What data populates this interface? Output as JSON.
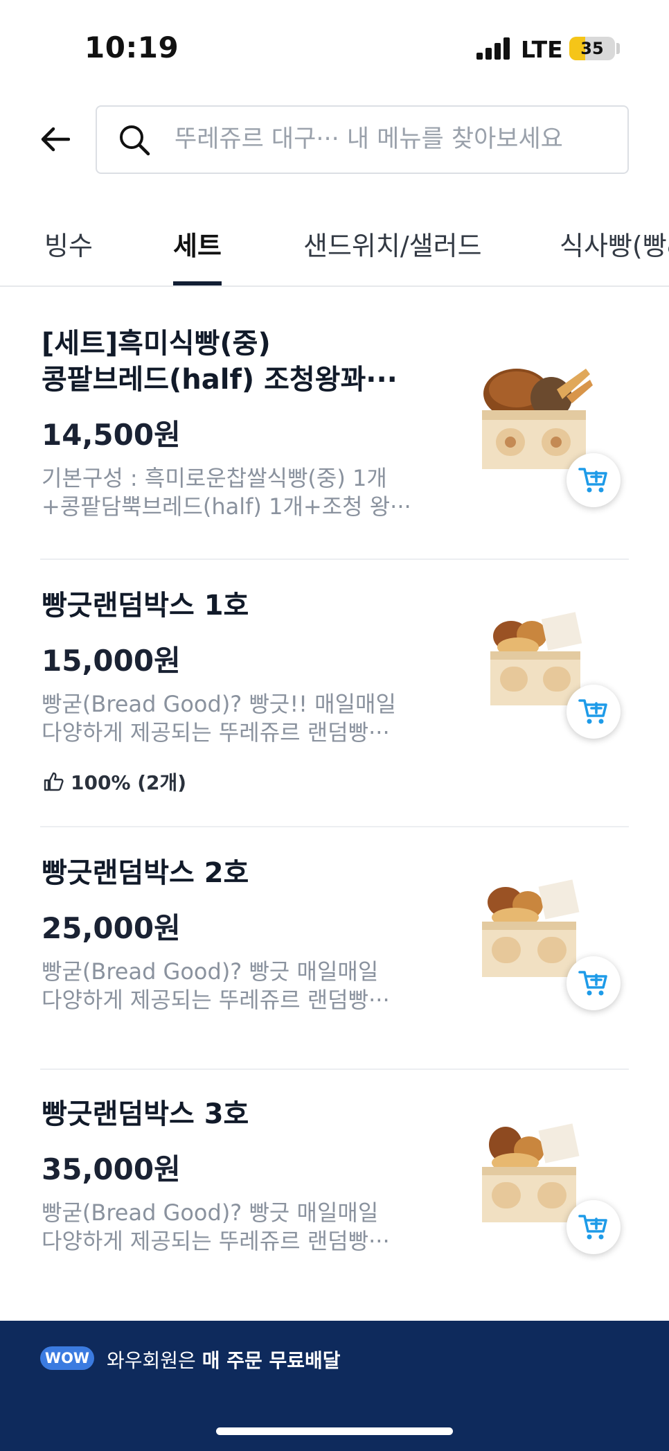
{
  "status_bar": {
    "time": "10:19",
    "network": "LTE",
    "battery": "35",
    "battery_level_percent": 35,
    "battery_color": "#f5c518"
  },
  "header": {
    "back_icon": "arrow-left-icon",
    "search_icon": "search-icon",
    "search_placeholder": "뚜레쥬르 대구··· 내 메뉴를 찾아보세요"
  },
  "tabs": [
    {
      "label": "빙수",
      "active": false
    },
    {
      "label": "세트",
      "active": true
    },
    {
      "label": "샌드위치/샐러드",
      "active": false
    },
    {
      "label": "식사빵(빵&",
      "active": false
    }
  ],
  "products": [
    {
      "name_line1": "[세트]흑미식빵(중)",
      "name_line2": "콩팥브레드(half) 조청왕꽈···",
      "price": "14,500원",
      "desc_line1": "기본구성 : 흑미로운찹쌀식빵(중) 1개",
      "desc_line2": "+콩팥담뿍브레드(half) 1개+조청 왕···",
      "rating": ""
    },
    {
      "name_line1": "빵긋랜덤박스 1호",
      "name_line2": "",
      "price": "15,000원",
      "desc_line1": "빵굳(Bread Good)? 빵긋!! 매일매일",
      "desc_line2": "다양하게 제공되는 뚜레쥬르 랜덤빵···",
      "rating": "100% (2개)"
    },
    {
      "name_line1": "빵긋랜덤박스 2호",
      "name_line2": "",
      "price": "25,000원",
      "desc_line1": "빵굳(Bread Good)? 빵긋 매일매일",
      "desc_line2": "다양하게 제공되는 뚜레쥬르 랜덤빵···",
      "rating": ""
    },
    {
      "name_line1": "빵긋랜덤박스 3호",
      "name_line2": "",
      "price": "35,000원",
      "desc_line1": "빵굳(Bread Good)? 빵긋 매일매일",
      "desc_line2": "다양하게 제공되는 뚜레쥬르 랜덤빵···",
      "rating": ""
    }
  ],
  "banner": {
    "badge": "WOW",
    "text_normal": "와우회원은 ",
    "text_bold": "매 주문 무료배달"
  },
  "colors": {
    "accent": "#1e9be8",
    "banner_bg": "#0e2a5c",
    "badge_bg": "#3b7be0"
  }
}
